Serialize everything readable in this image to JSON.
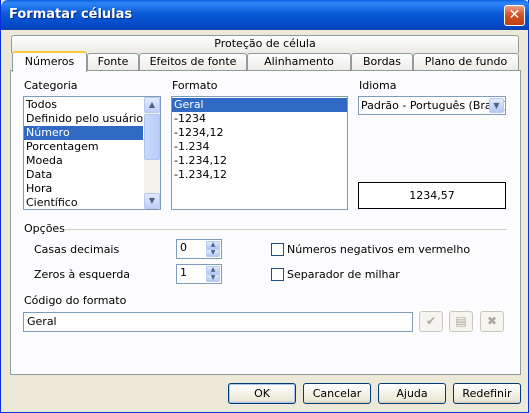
{
  "window": {
    "title": "Formatar células",
    "close_glyph": "✕"
  },
  "tabs": {
    "row1": [
      "Proteção de célula"
    ],
    "row2": [
      "Números",
      "Fonte",
      "Efeitos de fonte",
      "Alinhamento",
      "Bordas",
      "Plano de fundo"
    ],
    "active": "Números"
  },
  "category": {
    "label": "Categoria",
    "items": [
      "Todos",
      "Definido pelo usuário",
      "Número",
      "Porcentagem",
      "Moeda",
      "Data",
      "Hora",
      "Científico"
    ],
    "selected": "Número"
  },
  "format": {
    "label": "Formato",
    "items": [
      "Geral",
      "-1234",
      "-1234,12",
      "-1.234",
      "-1.234,12",
      "-1.234,12"
    ],
    "selected": "Geral"
  },
  "language": {
    "label": "Idioma",
    "value": "Padrão - Português (Brasil)"
  },
  "preview": {
    "value": "1234,57"
  },
  "options": {
    "label": "Opções",
    "decimal_places_label": "Casas decimais",
    "decimal_places_value": "0",
    "leading_zeros_label": "Zeros à esquerda",
    "leading_zeros_value": "1",
    "negative_red_label": "Números negativos em vermelho",
    "negative_red_checked": false,
    "thousands_sep_label": "Separador de milhar",
    "thousands_sep_checked": false
  },
  "format_code": {
    "label": "Código do formato",
    "value": "Geral"
  },
  "buttons": {
    "ok": "OK",
    "cancel": "Cancelar",
    "help": "Ajuda",
    "reset": "Redefinir"
  },
  "colors": {
    "title_bar": "#0b5bd8",
    "selection": "#316ac5",
    "tab_highlight": "#ffc83c"
  }
}
